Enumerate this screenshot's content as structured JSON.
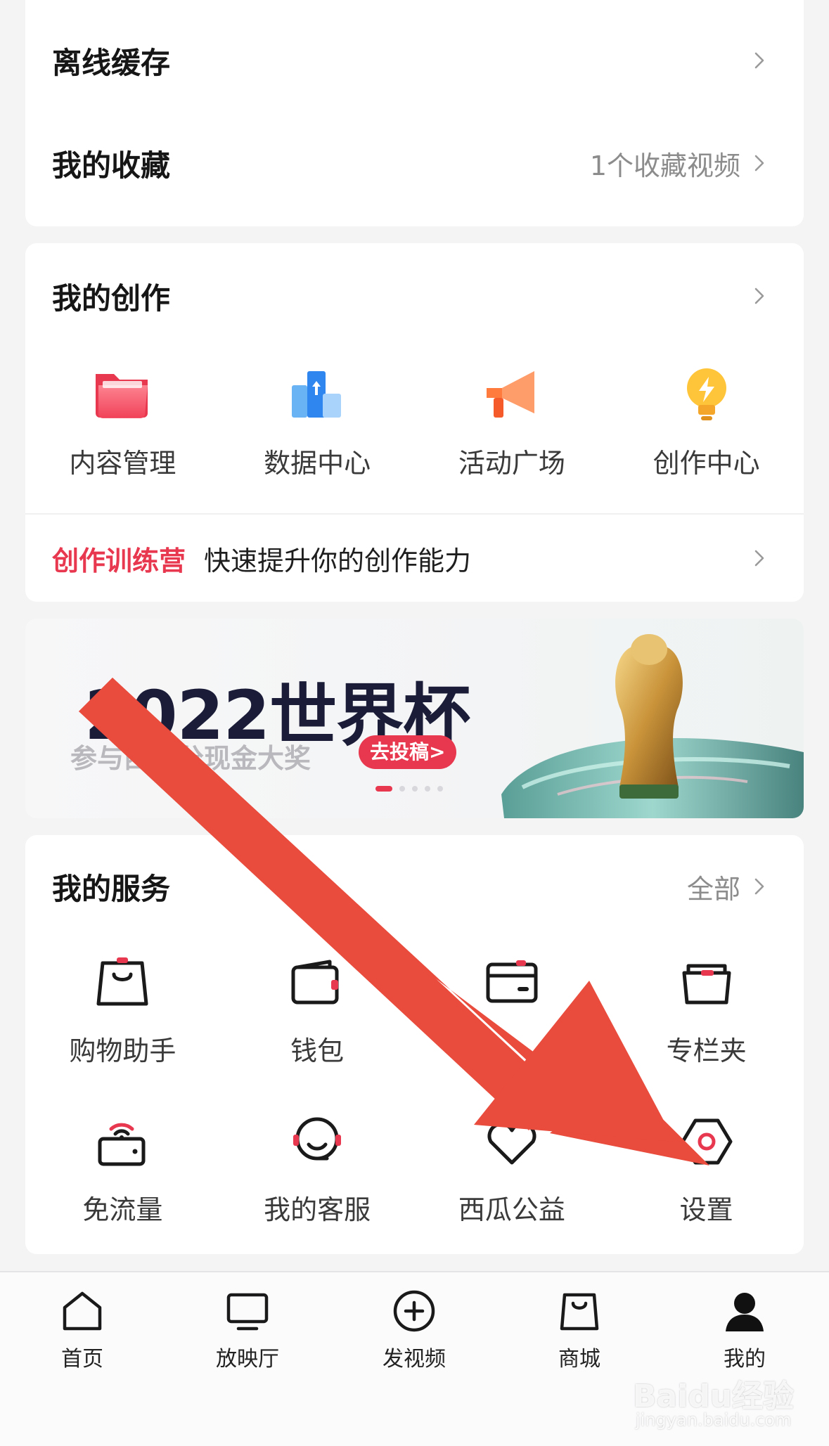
{
  "storage_card": {
    "offline_cache_label": "离线缓存",
    "favorites_label": "我的收藏",
    "favorites_value": "1个收藏视频"
  },
  "creation_card": {
    "title": "我的创作",
    "items": [
      {
        "label": "内容管理",
        "icon": "folder-icon"
      },
      {
        "label": "数据中心",
        "icon": "data-chart-icon"
      },
      {
        "label": "活动广场",
        "icon": "megaphone-icon"
      },
      {
        "label": "创作中心",
        "icon": "lightbulb-icon"
      }
    ],
    "camp_tag": "创作训练营",
    "camp_text": "快速提升你的创作能力"
  },
  "banner": {
    "title": "2022世界杯",
    "subtitle": "参与西瓜分现金大奖",
    "button_label": "去投稿>",
    "slides_total": 5,
    "active_slide": 1
  },
  "services_card": {
    "title": "我的服务",
    "all_label": "全部",
    "items": [
      {
        "label": "购物助手",
        "icon": "shopping-bag-icon"
      },
      {
        "label": "钱包",
        "icon": "wallet-icon"
      },
      {
        "label": "",
        "icon": "card-icon"
      },
      {
        "label": "专栏夹",
        "icon": "column-folder-icon"
      },
      {
        "label": "免流量",
        "icon": "free-data-icon"
      },
      {
        "label": "我的客服",
        "icon": "headset-icon"
      },
      {
        "label": "西瓜公益",
        "icon": "heart-icon"
      },
      {
        "label": "设置",
        "icon": "settings-hexagon-icon"
      }
    ]
  },
  "tabbar": {
    "items": [
      {
        "label": "首页",
        "icon": "home-icon"
      },
      {
        "label": "放映厅",
        "icon": "tv-icon"
      },
      {
        "label": "发视频",
        "icon": "plus-circle-icon"
      },
      {
        "label": "商城",
        "icon": "mall-bag-icon"
      },
      {
        "label": "我的",
        "icon": "profile-icon"
      }
    ],
    "active": "我的"
  },
  "watermark": {
    "text": "Baidu经验",
    "url": "jingyan.baidu.com"
  },
  "colors": {
    "accent": "#e8384f",
    "annotation_arrow": "#e94b3c",
    "background": "#f4f4f5"
  }
}
